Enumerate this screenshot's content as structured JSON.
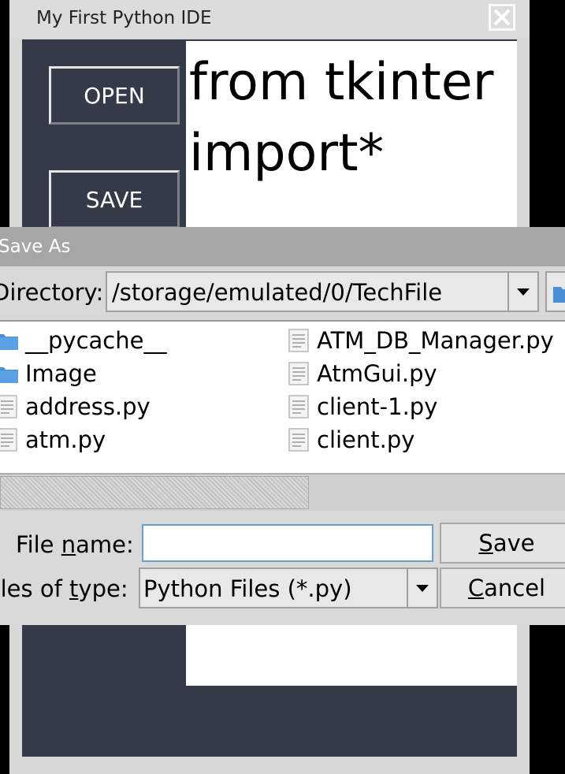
{
  "ide": {
    "title": "My First Python IDE",
    "open_label": "OPEN",
    "save_label": "SAVE",
    "editor_text": "from tkinter\nimport*"
  },
  "dialog": {
    "title": "Save As",
    "directory_label": "Directory:",
    "directory_value": "/storage/emulated/0/TechFile",
    "files_left": [
      {
        "name": "__pycache__",
        "icon": "folder-icon"
      },
      {
        "name": "Image",
        "icon": "folder-icon"
      },
      {
        "name": "address.py",
        "icon": "file-icon"
      },
      {
        "name": "atm.py",
        "icon": "file-icon"
      }
    ],
    "files_right": [
      {
        "name": "ATM_DB_Manager.py",
        "icon": "file-icon"
      },
      {
        "name": "AtmGui.py",
        "icon": "file-icon"
      },
      {
        "name": "client-1.py",
        "icon": "file-icon"
      },
      {
        "name": "client.py",
        "icon": "file-icon"
      }
    ],
    "file_name_label_pre": "File ",
    "file_name_label_u": "n",
    "file_name_label_post": "ame:",
    "file_name_value": "",
    "files_of_type_label_pre": "Files of ",
    "files_of_type_label_u": "t",
    "files_of_type_label_post": "ype:",
    "files_of_type_value": "Python Files (*.py)",
    "save_u": "S",
    "save_rest": "ave",
    "cancel_u": "C",
    "cancel_rest": "ancel"
  },
  "colors": {
    "ide_background": "#343a48",
    "dialog_titlebar": "#a6a6a6",
    "folder_icon": "#4a8fd6"
  }
}
